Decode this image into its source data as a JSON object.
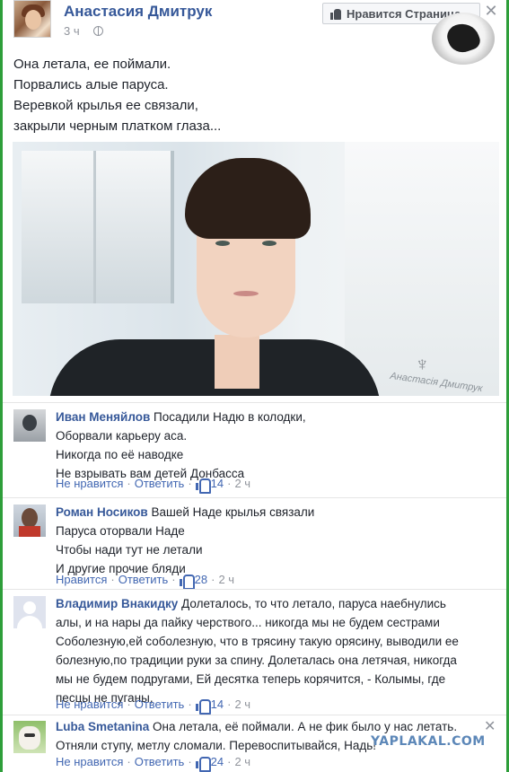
{
  "post": {
    "author": "Анастасия Дмитрук",
    "time": "3 ч",
    "like_page_label": "Нравится Страница",
    "close_symbol": "✕",
    "lines": [
      "Она летала, ее поймали.",
      "Порвались алые паруса.",
      "Веревкой крылья ее связали,",
      "закрыли черным платком глаза..."
    ],
    "photo_signature": "Анастасія Дмитрук",
    "photo_emblem": "♆"
  },
  "comments": [
    {
      "author": "Иван Меняйлов",
      "lines": [
        "Посадили Надю в колодки,",
        "Оборвали карьеру аса.",
        "Никогда по её наводке",
        "Не взрывать вам детей Донбасса"
      ],
      "dislike_label": "Не нравится",
      "reply_label": "Ответить",
      "likes": "14",
      "time": "2 ч"
    },
    {
      "author": "Роман Носиков",
      "lines": [
        "Вашей Наде крылья связали",
        "Паруса оторвали Наде",
        "Чтобы нади тут не летали",
        "И другие прочие бляди"
      ],
      "dislike_label": "Нравится",
      "reply_label": "Ответить",
      "likes": "28",
      "time": "2 ч"
    },
    {
      "author": "Владимир Внакидку",
      "lines": [
        "Долеталось, то что летало, паруса наебнулись",
        "алы, и на нары да пайку черствого... никогда мы не будем сестрами",
        "Соболезную,ей соболезную, что в трясину такую орясину, выводили ее",
        "болезную,по традиции руки за спину. Долеталась она летячая, никогда",
        "мы не будем подругами, Ей десятка теперь корячится, - Колымы, где",
        "песцы не пуганы,"
      ],
      "dislike_label": "Не нравится",
      "reply_label": "Ответить",
      "likes": "14",
      "time": "2 ч"
    },
    {
      "author": "Luba Smetanina",
      "lines": [
        "Она летала, её поймали. А не фик было у нас летать.",
        "Отняли ступу, метлу сломали. Перевоспитывайся, Надь!"
      ],
      "dislike_label": "Не нравится",
      "reply_label": "Ответить",
      "likes": "24",
      "time": "2 ч",
      "close_symbol": "✕"
    }
  ],
  "watermark": "YAPLAKAL.COM",
  "colors": {
    "border_green": "#2e9e3a",
    "link_blue": "#365899",
    "action_blue": "#4267b2",
    "muted_gray": "#90949c"
  }
}
